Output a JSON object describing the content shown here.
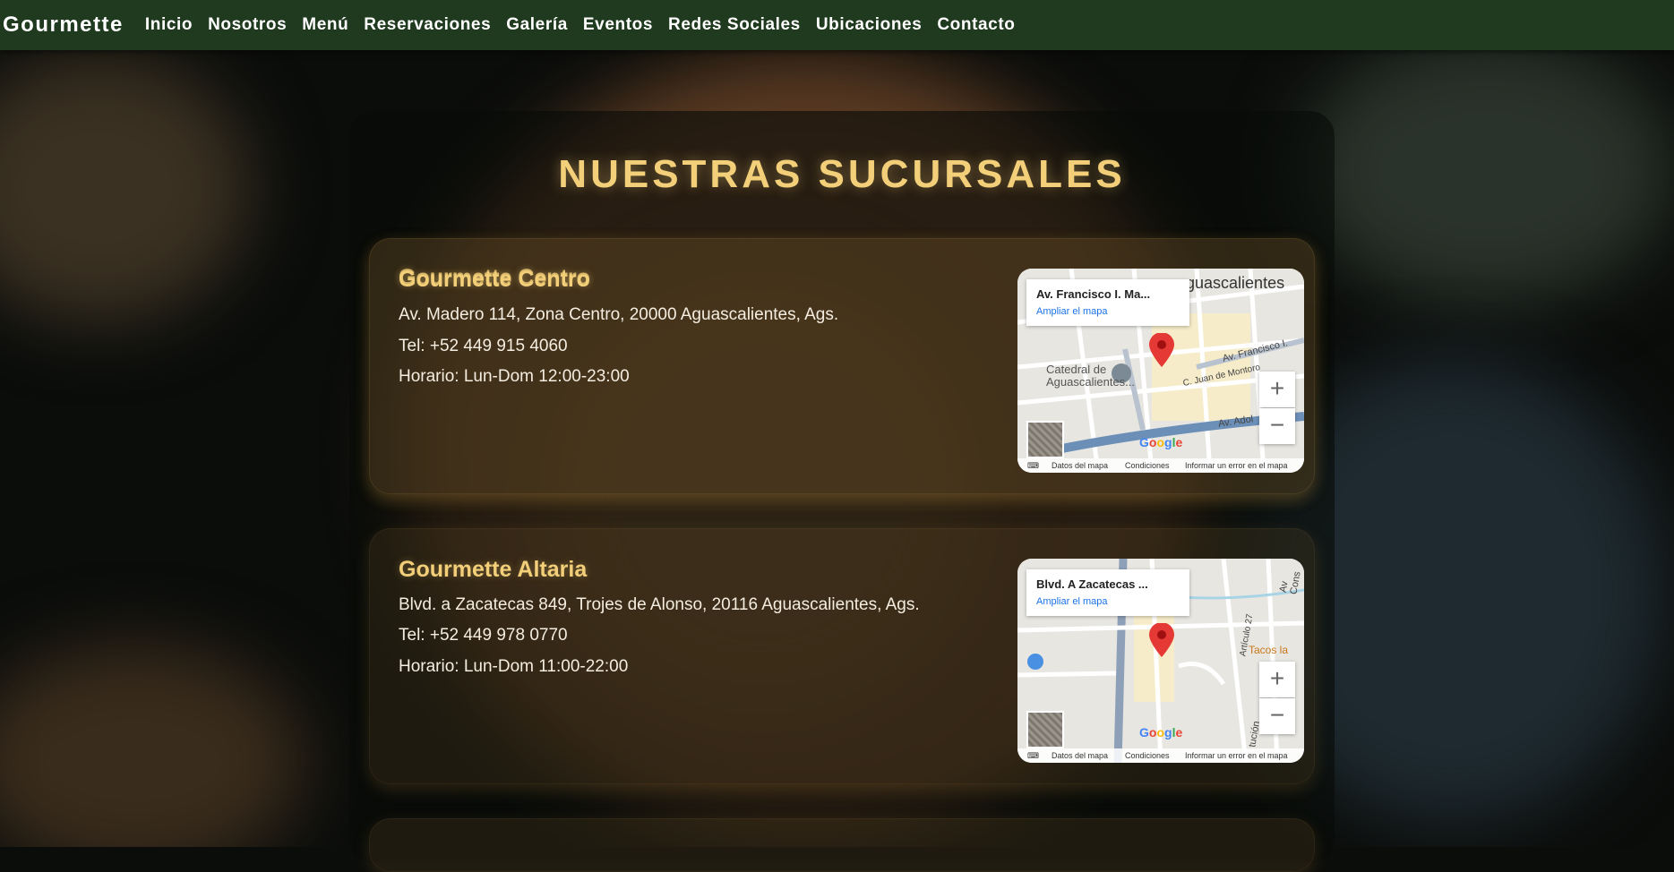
{
  "brand": "Gourmette",
  "nav": [
    "Inicio",
    "Nosotros",
    "Menú",
    "Reservaciones",
    "Galería",
    "Eventos",
    "Redes Sociales",
    "Ubicaciones",
    "Contacto"
  ],
  "page_title": "NUESTRAS SUCURSALES",
  "locations": [
    {
      "name": "Gourmette Centro",
      "address": "Av. Madero 114, Zona Centro, 20000 Aguascalientes, Ags.",
      "phone": "Tel: +52 449 915 4060",
      "hours": "Horario: Lun-Dom 12:00-23:00",
      "map": {
        "place": "Av. Francisco I. Ma...",
        "city_label": "guascalientes",
        "landmark": "Catedral de Aguascalientes...",
        "streets": [
          "Av. Francisco I.",
          "C. Juan de Montoro",
          "Av. Adol"
        ]
      }
    },
    {
      "name": "Gourmette Altaria",
      "address": "Blvd. a Zacatecas 849, Trojes de Alonso, 20116 Aguascalientes, Ags.",
      "phone": "Tel: +52 449 978 0770",
      "hours": "Horario: Lun-Dom 11:00-22:00",
      "map": {
        "place": "Blvd. A Zacatecas ...",
        "poi": "Tacos la",
        "streets": [
          "Av Cons",
          "Artículo 27",
          "tución"
        ]
      }
    }
  ],
  "map_ui": {
    "expand_link": "Ampliar el mapa",
    "zoom_in": "+",
    "zoom_out": "−",
    "google": "Google",
    "keyboard": "⌨",
    "map_data": "Datos del mapa",
    "terms": "Condiciones",
    "report": "Informar un error en el mapa"
  },
  "colors": {
    "nav_bg": "#1f3a1e",
    "accent_gold": "#f2cf78",
    "map_pin": "#e53935"
  }
}
